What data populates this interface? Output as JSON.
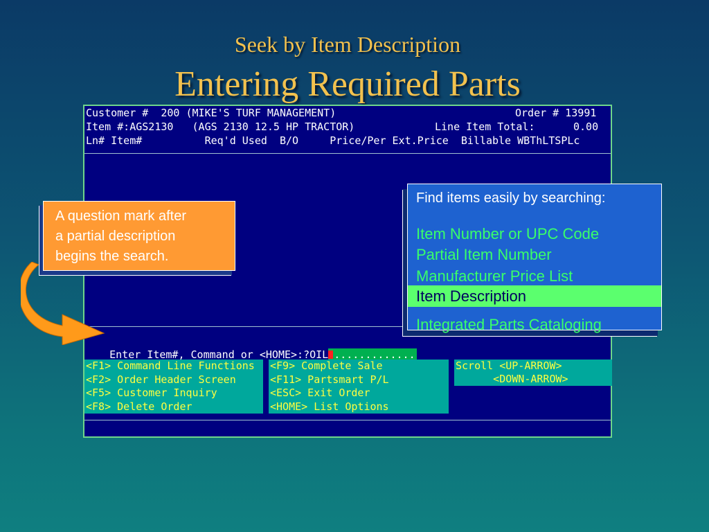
{
  "slide": {
    "subtitle": "Seek by Item Description",
    "title": "Entering Required Parts"
  },
  "terminal": {
    "header": {
      "customer": "Customer #  200 (MIKE'S TURF MANAGEMENT)",
      "order": "Order # 13991",
      "item": "Item #:AGS2130   (AGS 2130 12.5 HP TRACTOR)",
      "line_total_label": "Line Item Total:",
      "line_total_value": "0.00",
      "columns": "Ln# Item#          Req'd Used  B/O     Price/Per Ext.Price  Billable WBThLTSPLc"
    },
    "command": {
      "prompt": "Enter Item#, Command or <HOME>:",
      "value": "?OIL",
      "fill": "............."
    },
    "function_keys_left": [
      "<F1> Command Line Functions",
      "<F2> Order Header Screen",
      "<F5> Customer Inquiry",
      "<F8> Delete Order"
    ],
    "function_keys_middle": [
      "<F9> Complete Sale",
      "<F11> Partsmart P/L",
      "<ESC> Exit Order",
      "<HOME> List Options"
    ],
    "scroll": [
      "Scroll <UP-ARROW>",
      "      <DOWN-ARROW>"
    ]
  },
  "callout": {
    "lines": [
      "A question mark after",
      "a partial description",
      "begins the search."
    ]
  },
  "search_panel": {
    "heading": "Find items easily by searching:",
    "items": [
      "Item Number or UPC Code",
      "Partial Item Number",
      "Manufacturer Price List",
      "Item Description",
      "Integrated Parts Cataloging"
    ],
    "selected_index": 3
  },
  "colors": {
    "title": "#f2c14e",
    "terminal_bg": "#000080",
    "fkey_bg": "#00a89c",
    "callout_bg": "#ff9a33",
    "panel_bg": "#1e62d0",
    "highlight": "#5bff6e"
  }
}
